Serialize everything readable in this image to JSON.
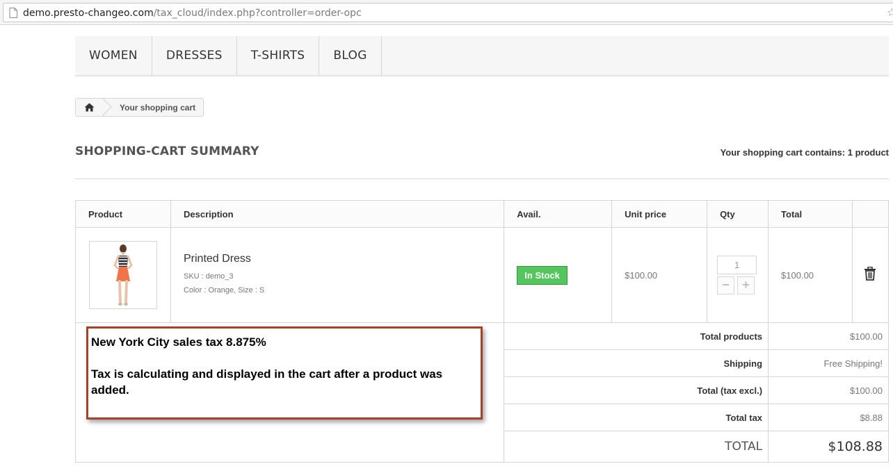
{
  "browser": {
    "url_host": "demo.presto-changeo.com",
    "url_path": "/tax_cloud/index.php?controller=order-opc"
  },
  "menu": [
    {
      "label": "WOMEN"
    },
    {
      "label": "DRESSES"
    },
    {
      "label": "T-SHIRTS"
    },
    {
      "label": "BLOG"
    }
  ],
  "breadcrumb": {
    "current": "Your shopping cart"
  },
  "heading": {
    "title": "SHOPPING-CART SUMMARY",
    "cart_count": "Your shopping cart contains: 1 product"
  },
  "table": {
    "headers": {
      "product": "Product",
      "description": "Description",
      "avail": "Avail.",
      "unit_price": "Unit price",
      "qty": "Qty",
      "total": "Total"
    },
    "item": {
      "name": "Printed Dress",
      "sku": "SKU : demo_3",
      "attributes": "Color : Orange, Size : S",
      "availability": "In Stock",
      "unit_price": "$100.00",
      "qty": "1",
      "qty_minus": "−",
      "qty_plus": "+",
      "total": "$100.00"
    },
    "summary": {
      "total_products_label": "Total products",
      "total_products_value": "$100.00",
      "shipping_label": "Shipping",
      "shipping_value": "Free Shipping!",
      "total_excl_label": "Total (tax excl.)",
      "total_excl_value": "$100.00",
      "total_tax_label": "Total tax",
      "total_tax_value": "$8.88",
      "grand_total_label": "TOTAL",
      "grand_total_value": "$108.88"
    }
  },
  "annotation": {
    "line1": "New York City sales tax 8.875%",
    "line2": "Tax is calculating and displayed in the cart after a product was added."
  },
  "colors": {
    "in_stock_badge": "#55c65e",
    "annotation_border": "#a8412b",
    "dress_top": "#2b2b2b",
    "dress_skirt": "#f0744a"
  },
  "icons": [
    "page-icon",
    "bookmark-star-icon",
    "home-icon",
    "trash-icon"
  ]
}
